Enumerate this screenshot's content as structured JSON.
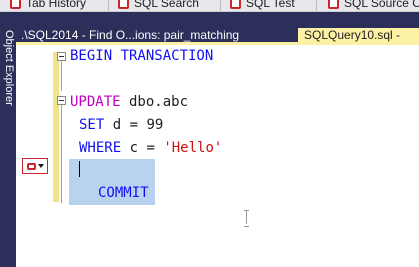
{
  "toolbar": {
    "buttons": [
      {
        "label": "Tab History",
        "icon": "tab-history-icon"
      },
      {
        "label": "SQL Search",
        "icon": "sql-search-icon"
      },
      {
        "label": "SQL Test",
        "icon": "sql-test-icon"
      },
      {
        "label": "SQL Source C",
        "icon": "sql-source-control-icon"
      }
    ]
  },
  "sidebar": {
    "label": "Object Explorer"
  },
  "tabs": [
    {
      "label": ".\\SQL2014 - Find O...ions: pair_matching",
      "active": false
    },
    {
      "label": "SQLQuery10.sql -",
      "active": true
    }
  ],
  "editor": {
    "lines": {
      "begin": "BEGIN TRANSACTION",
      "update_kw": "UPDATE",
      "update_rest": " dbo.abc",
      "set_kw": "SET",
      "set_rest": " d = 99",
      "where_kw": "WHERE",
      "where_mid": " c = ",
      "where_str": "'Hello'",
      "commit": "COMMIT"
    },
    "colors": {
      "keyword": "#1111ee",
      "update_keyword": "#c000c0",
      "string": "#cc1111",
      "selection": "#b8d3f0",
      "changed_margin": "#f0e48a",
      "active_tab": "#fcf1a5",
      "chrome": "#2b2f5a"
    }
  }
}
